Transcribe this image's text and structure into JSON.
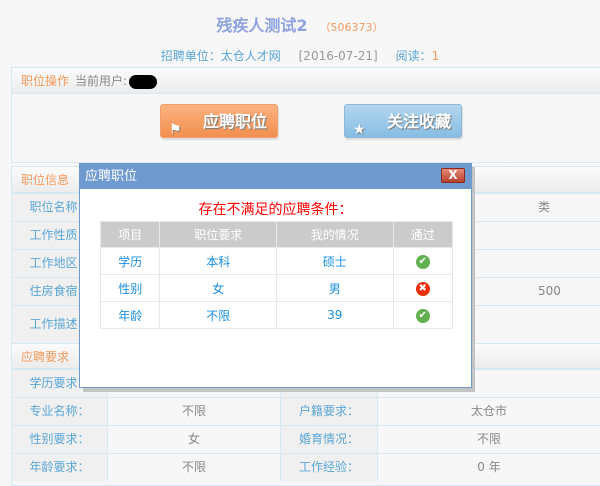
{
  "job": {
    "title": "残疾人测试2",
    "id": "（506373）"
  },
  "meta": {
    "company_label": "招聘单位：",
    "company": "太仓人才网",
    "date": "[2016-07-21]",
    "read_label": "阅读：",
    "read_count": "1"
  },
  "ops": {
    "title": "职位操作",
    "user_label": "当前用户:",
    "apply": "应聘职位",
    "favorite": "关注收藏"
  },
  "info": {
    "title": "职位信息",
    "rows": [
      {
        "label": "职位名称：",
        "value": "",
        "label2": "",
        "value2": "类"
      },
      {
        "label": "工作性质：",
        "value": "",
        "label2": "",
        "value2": ""
      },
      {
        "label": "工作地区：",
        "value": "",
        "label2": "",
        "value2": ""
      },
      {
        "label": "住房食宿：",
        "value": "",
        "label2": "",
        "value2": "500"
      },
      {
        "label": "工作描述：",
        "value": "",
        "label2": "",
        "value2": ""
      }
    ]
  },
  "req": {
    "title": "应聘要求",
    "rows": [
      {
        "label": "学历要求：",
        "value": "",
        "label2": "",
        "value2": ""
      },
      {
        "label": "专业名称：",
        "value": "不限",
        "label2": "户籍要求：",
        "value2": "太仓市"
      },
      {
        "label": "性别要求：",
        "value": "女",
        "label2": "婚育情况：",
        "value2": "不限"
      },
      {
        "label": "年龄要求：",
        "value": "不限",
        "label2": "工作经验：",
        "value2": "0 年"
      }
    ]
  },
  "modal": {
    "title": "应聘职位",
    "close": "X",
    "warning": "存在不满足的应聘条件：",
    "headers": [
      "项目",
      "职位要求",
      "我的情况",
      "通过"
    ],
    "rows": [
      {
        "item": "学历",
        "required": "本科",
        "mine": "硕士",
        "pass": true,
        "icon": "✔"
      },
      {
        "item": "性别",
        "required": "女",
        "mine": "男",
        "pass": false,
        "icon": "✖"
      },
      {
        "item": "年龄",
        "required": "不限",
        "mine": "39",
        "pass": true,
        "icon": "✔"
      }
    ]
  }
}
